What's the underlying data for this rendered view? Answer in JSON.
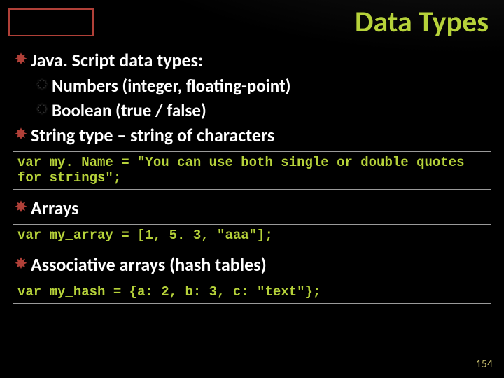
{
  "title": "Data Types",
  "bullets": {
    "b1": "Java. Script data types:",
    "b1a": "Numbers (integer, floating-point)",
    "b1b": "Boolean (true / false)",
    "b2": "String type – string of characters",
    "b3": "Arrays",
    "b4": "Associative arrays (hash tables)"
  },
  "code": {
    "c1": "var my. Name = \"You can use both single or double quotes for strings\";",
    "c2": "var my_array = [1, 5. 3, \"aaa\"];",
    "c3": "var my_hash = {a: 2, b: 3, c: \"text\"};"
  },
  "page_number": "154"
}
